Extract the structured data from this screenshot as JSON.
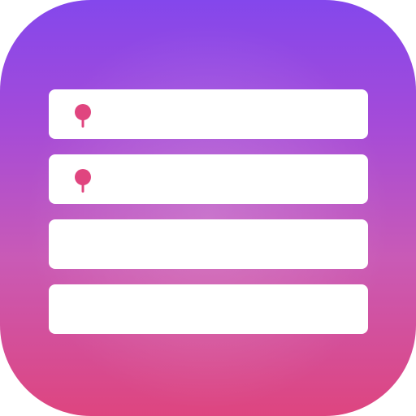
{
  "icon": {
    "name": "list-app-icon",
    "colors": {
      "gradient_top": "#8447EC",
      "gradient_mid": "#C95AB6",
      "gradient_bottom": "#DE457F",
      "row_fill": "#FFFFFF",
      "pin_color": "#E0457F"
    },
    "rows": [
      {
        "marker": "pin-icon"
      },
      {
        "marker": "pin-icon"
      },
      {
        "marker": ""
      },
      {
        "marker": ""
      }
    ]
  }
}
